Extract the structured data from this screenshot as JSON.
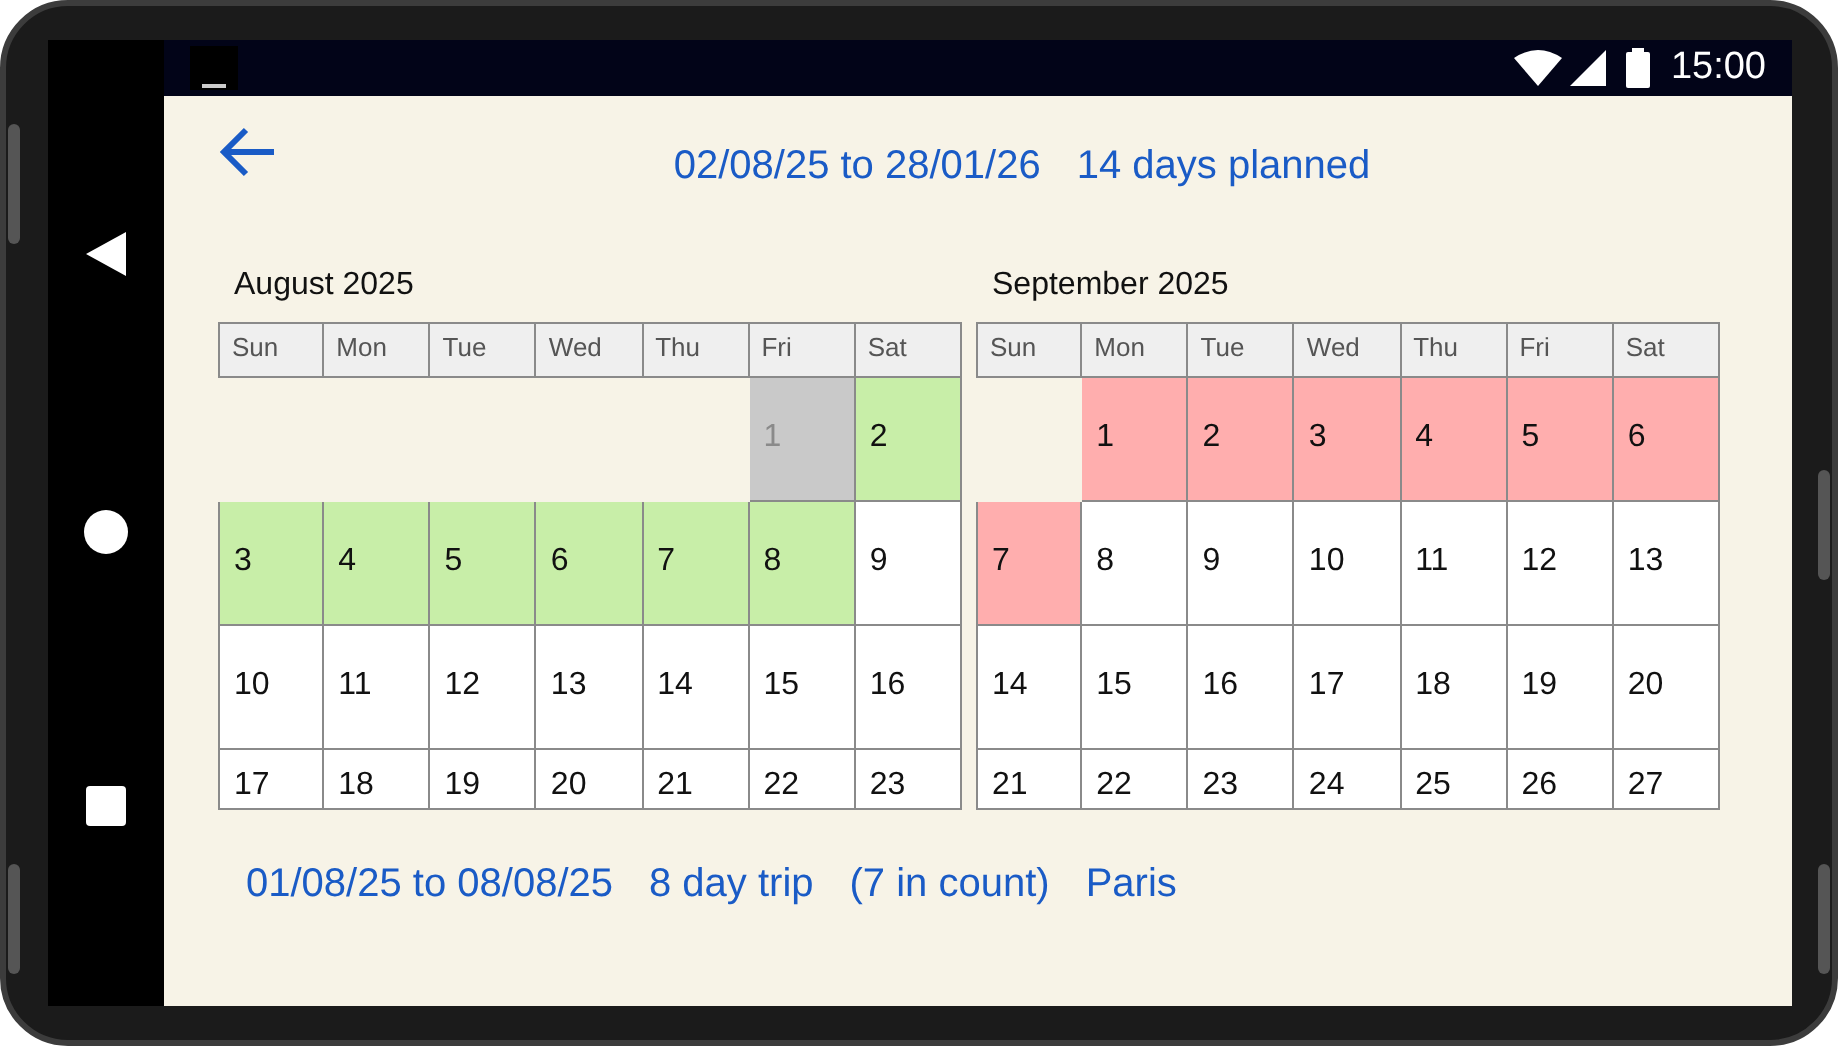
{
  "status_bar": {
    "time": "15:00"
  },
  "header": {
    "range": "02/08/25 to 28/01/26",
    "summary": "14 days planned"
  },
  "months": [
    {
      "title": "August 2025",
      "weekdays": [
        "Sun",
        "Mon",
        "Tue",
        "Wed",
        "Thu",
        "Fri",
        "Sat"
      ],
      "weeks": [
        [
          {
            "kind": "blank"
          },
          {
            "kind": "blank"
          },
          {
            "kind": "blank"
          },
          {
            "kind": "blank"
          },
          {
            "kind": "blank"
          },
          {
            "kind": "day",
            "day": "1",
            "color": "#c9c9c9",
            "disabled": true
          },
          {
            "kind": "day",
            "day": "2",
            "color": "#c8eea8",
            "disabled": false
          }
        ],
        [
          {
            "kind": "day",
            "day": "3",
            "color": "#c8eea8",
            "disabled": false
          },
          {
            "kind": "day",
            "day": "4",
            "color": "#c8eea8",
            "disabled": false
          },
          {
            "kind": "day",
            "day": "5",
            "color": "#c8eea8",
            "disabled": false
          },
          {
            "kind": "day",
            "day": "6",
            "color": "#c8eea8",
            "disabled": false
          },
          {
            "kind": "day",
            "day": "7",
            "color": "#c8eea8",
            "disabled": false
          },
          {
            "kind": "day",
            "day": "8",
            "color": "#c8eea8",
            "disabled": false
          },
          {
            "kind": "day",
            "day": "9",
            "color": "#ffffff",
            "disabled": false
          }
        ],
        [
          {
            "kind": "day",
            "day": "10",
            "color": "#ffffff",
            "disabled": false
          },
          {
            "kind": "day",
            "day": "11",
            "color": "#ffffff",
            "disabled": false
          },
          {
            "kind": "day",
            "day": "12",
            "color": "#ffffff",
            "disabled": false
          },
          {
            "kind": "day",
            "day": "13",
            "color": "#ffffff",
            "disabled": false
          },
          {
            "kind": "day",
            "day": "14",
            "color": "#ffffff",
            "disabled": false
          },
          {
            "kind": "day",
            "day": "15",
            "color": "#ffffff",
            "disabled": false
          },
          {
            "kind": "day",
            "day": "16",
            "color": "#ffffff",
            "disabled": false
          }
        ],
        [
          {
            "kind": "day",
            "day": "17",
            "color": "#ffffff",
            "disabled": false
          },
          {
            "kind": "day",
            "day": "18",
            "color": "#ffffff",
            "disabled": false
          },
          {
            "kind": "day",
            "day": "19",
            "color": "#ffffff",
            "disabled": false
          },
          {
            "kind": "day",
            "day": "20",
            "color": "#ffffff",
            "disabled": false
          },
          {
            "kind": "day",
            "day": "21",
            "color": "#ffffff",
            "disabled": false
          },
          {
            "kind": "day",
            "day": "22",
            "color": "#ffffff",
            "disabled": false
          },
          {
            "kind": "day",
            "day": "23",
            "color": "#ffffff",
            "disabled": false
          }
        ]
      ]
    },
    {
      "title": "September 2025",
      "weekdays": [
        "Sun",
        "Mon",
        "Tue",
        "Wed",
        "Thu",
        "Fri",
        "Sat"
      ],
      "weeks": [
        [
          {
            "kind": "blank"
          },
          {
            "kind": "day",
            "day": "1",
            "color": "#ffaeae",
            "disabled": false
          },
          {
            "kind": "day",
            "day": "2",
            "color": "#ffaeae",
            "disabled": false
          },
          {
            "kind": "day",
            "day": "3",
            "color": "#ffaeae",
            "disabled": false
          },
          {
            "kind": "day",
            "day": "4",
            "color": "#ffaeae",
            "disabled": false
          },
          {
            "kind": "day",
            "day": "5",
            "color": "#ffaeae",
            "disabled": false
          },
          {
            "kind": "day",
            "day": "6",
            "color": "#ffaeae",
            "disabled": false
          }
        ],
        [
          {
            "kind": "day",
            "day": "7",
            "color": "#ffaeae",
            "disabled": false
          },
          {
            "kind": "day",
            "day": "8",
            "color": "#ffffff",
            "disabled": false
          },
          {
            "kind": "day",
            "day": "9",
            "color": "#ffffff",
            "disabled": false
          },
          {
            "kind": "day",
            "day": "10",
            "color": "#ffffff",
            "disabled": false
          },
          {
            "kind": "day",
            "day": "11",
            "color": "#ffffff",
            "disabled": false
          },
          {
            "kind": "day",
            "day": "12",
            "color": "#ffffff",
            "disabled": false
          },
          {
            "kind": "day",
            "day": "13",
            "color": "#ffffff",
            "disabled": false
          }
        ],
        [
          {
            "kind": "day",
            "day": "14",
            "color": "#ffffff",
            "disabled": false
          },
          {
            "kind": "day",
            "day": "15",
            "color": "#ffffff",
            "disabled": false
          },
          {
            "kind": "day",
            "day": "16",
            "color": "#ffffff",
            "disabled": false
          },
          {
            "kind": "day",
            "day": "17",
            "color": "#ffffff",
            "disabled": false
          },
          {
            "kind": "day",
            "day": "18",
            "color": "#ffffff",
            "disabled": false
          },
          {
            "kind": "day",
            "day": "19",
            "color": "#ffffff",
            "disabled": false
          },
          {
            "kind": "day",
            "day": "20",
            "color": "#ffffff",
            "disabled": false
          }
        ],
        [
          {
            "kind": "day",
            "day": "21",
            "color": "#ffffff",
            "disabled": false
          },
          {
            "kind": "day",
            "day": "22",
            "color": "#ffffff",
            "disabled": false
          },
          {
            "kind": "day",
            "day": "23",
            "color": "#ffffff",
            "disabled": false
          },
          {
            "kind": "day",
            "day": "24",
            "color": "#ffffff",
            "disabled": false
          },
          {
            "kind": "day",
            "day": "25",
            "color": "#ffffff",
            "disabled": false
          },
          {
            "kind": "day",
            "day": "26",
            "color": "#ffffff",
            "disabled": false
          },
          {
            "kind": "day",
            "day": "27",
            "color": "#ffffff",
            "disabled": false
          }
        ]
      ]
    }
  ],
  "footer": {
    "parts": [
      "01/08/25 to 08/08/25",
      "8 day trip",
      "(7 in count)",
      "Paris"
    ]
  }
}
